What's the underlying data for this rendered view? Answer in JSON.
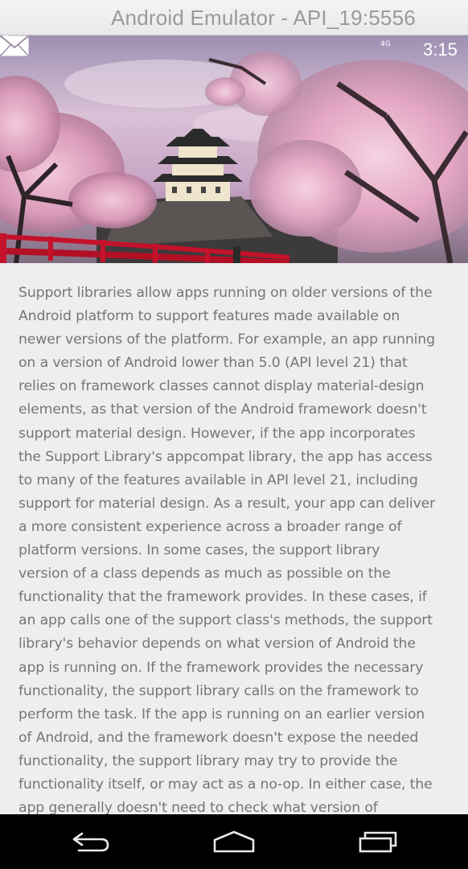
{
  "window": {
    "title": "Android Emulator - API_19:5556"
  },
  "status_bar": {
    "network": "4G",
    "time": "3:15",
    "icons": [
      "signal-icon",
      "battery-icon"
    ]
  },
  "hero": {
    "image_name": "cherry-blossom-castle-photo",
    "action_icon": "mail-icon"
  },
  "article": {
    "text": "Support libraries allow apps running on older versions of the\nAndroid platform to support features made available on\nnewer versions of the platform. For example, an app running\non a version of Android lower than 5.0 (API level 21) that\nrelies on framework classes cannot display material-design\nelements, as that version of the Android framework doesn't\nsupport material design. However, if the app incorporates\nthe Support Library's appcompat library, the app has access\nto many of the features available in API level 21, including\nsupport for material design. As a result, your app can deliver\na more consistent experience across a broader range of\nplatform versions.  In some cases, the support library\nversion of a class depends as much as possible on the\nfunctionality that the framework provides. In these cases, if\nan app calls one of the support class's methods, the support\nlibrary's behavior depends on what version of Android the\napp is running on. If the framework provides the necessary\nfunctionality, the support library calls on the framework to\nperform the task. If the app is running on an earlier version\nof Android, and the framework doesn't expose the needed\nfunctionality, the support library may try to provide the\nfunctionality itself, or may act as a no-op. In either case, the\napp generally doesn't need to check what version of"
  },
  "nav_bar": {
    "buttons": [
      "back-icon",
      "home-icon",
      "recents-icon"
    ]
  }
}
